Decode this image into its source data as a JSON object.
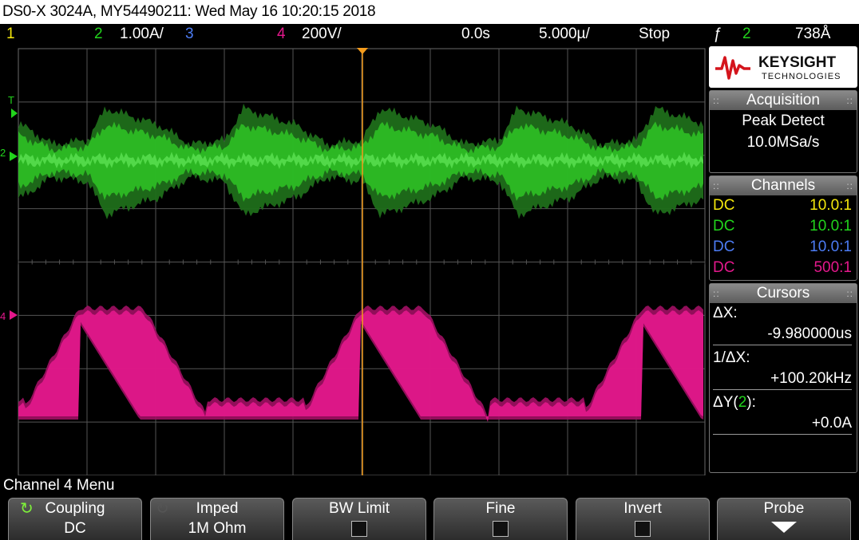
{
  "title": "DS0-X 3024A, MY54490211: Wed May 16 10:20:15 2018",
  "status": {
    "ch1_num": "1",
    "ch2_num": "2",
    "ch2_scale": "1.00A/",
    "ch3_num": "3",
    "ch4_num": "4",
    "ch4_scale": "200V/",
    "time_offset": "0.0s",
    "timebase": "5.000µ/",
    "run_state": "Stop",
    "trigger_edge": "ƒ",
    "trigger_channel": "2",
    "trigger_level": "738Å"
  },
  "colors": {
    "ch1": "#f4e80c",
    "ch2": "#22d41c",
    "ch3": "#4c7cf4",
    "ch4": "#e4188c",
    "trigger": "#f49c1c",
    "grid": "#6a6a6a"
  },
  "logo": {
    "brand": "KEYSIGHT",
    "sub": "TECHNOLOGIES"
  },
  "acquisition": {
    "title": "Acquisition",
    "mode": "Peak Detect",
    "rate": "10.0MSa/s"
  },
  "channels": {
    "title": "Channels",
    "rows": [
      {
        "coupling": "DC",
        "probe": "10.0:1"
      },
      {
        "coupling": "DC",
        "probe": "10.0:1"
      },
      {
        "coupling": "DC",
        "probe": "10.0:1"
      },
      {
        "coupling": "DC",
        "probe": "500:1"
      }
    ]
  },
  "cursors": {
    "title": "Cursors",
    "dx_label": "ΔX:",
    "dx_value": "-9.980000us",
    "inv_dx_label": "1/ΔX:",
    "inv_dx_value": "+100.20kHz",
    "dy_label_prefix": "ΔY(",
    "dy_channel": "2",
    "dy_label_suffix": "):",
    "dy_value": "+0.0A"
  },
  "waveform_markers": {
    "trigger_marker": "T",
    "ch2_marker": "2",
    "ch4_marker": "4"
  },
  "menu": {
    "title": "Channel 4 Menu",
    "softkeys": [
      {
        "label": "Coupling",
        "value": "DC",
        "icon": "rotate-icon",
        "active": true
      },
      {
        "label": "Imped",
        "value": "1M Ohm",
        "icon": "rotate-icon",
        "active": false
      },
      {
        "label": "BW Limit",
        "icon": "checkbox"
      },
      {
        "label": "Fine",
        "icon": "checkbox"
      },
      {
        "label": "Invert",
        "icon": "checkbox"
      },
      {
        "label": "Probe",
        "icon": "down-arrow-icon"
      }
    ]
  }
}
